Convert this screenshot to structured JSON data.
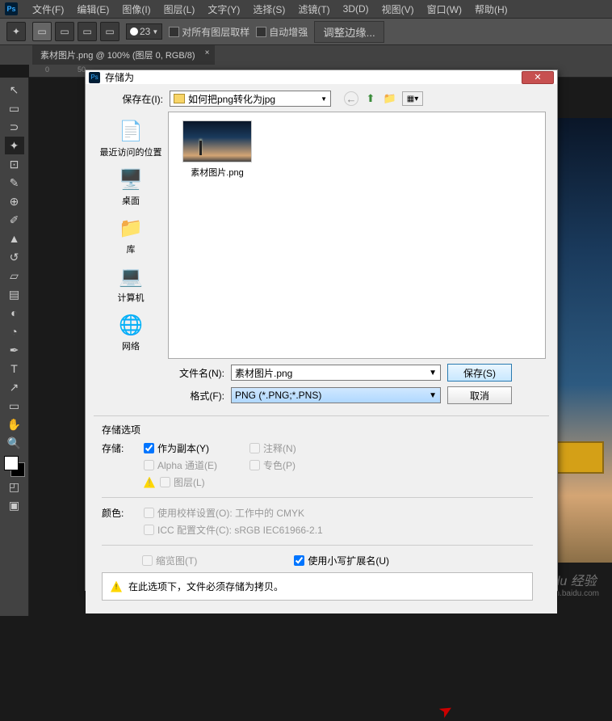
{
  "menubar": {
    "logo": "Ps",
    "items": [
      "文件(F)",
      "编辑(E)",
      "图像(I)",
      "图层(L)",
      "文字(Y)",
      "选择(S)",
      "滤镜(T)",
      "3D(D)",
      "视图(V)",
      "窗口(W)",
      "帮助(H)"
    ]
  },
  "optionsbar": {
    "size_value": "23",
    "chk1": "对所有图层取样",
    "chk2": "自动增强",
    "btn": "调整边缘..."
  },
  "tab": {
    "title": "素材图片.png @ 100% (图层 0, RGB/8)",
    "close": "×"
  },
  "dialog": {
    "title": "存储为",
    "close": "✕",
    "location_label": "保存在(I):",
    "location_value": "如何把png转化为jpg",
    "places": [
      {
        "label": "最近访问的位置",
        "icon": "📄"
      },
      {
        "label": "桌面",
        "icon": "🖥️"
      },
      {
        "label": "库",
        "icon": "📁"
      },
      {
        "label": "计算机",
        "icon": "💻"
      },
      {
        "label": "网络",
        "icon": "🌐"
      }
    ],
    "file_item": "素材图片.png",
    "filename_label": "文件名(N):",
    "filename_value": "素材图片.png",
    "format_label": "格式(F):",
    "format_value": "PNG (*.PNG;*.PNS)",
    "save_btn": "保存(S)",
    "cancel_btn": "取消",
    "options": {
      "heading": "存储选项",
      "save_label": "存储:",
      "as_copy": "作为副本(Y)",
      "alpha": "Alpha 通道(E)",
      "layers": "图层(L)",
      "notes": "注释(N)",
      "spot": "专色(P)",
      "color_label": "颜色:",
      "proof": "使用校样设置(O):  工作中的 CMYK",
      "icc": "ICC 配置文件(C):  sRGB IEC61966-2.1",
      "thumb": "缩览图(T)",
      "lowercase": "使用小写扩展名(U)",
      "info": "在此选项下，文件必须存储为拷贝。"
    }
  },
  "watermark": {
    "main": "Baidu 经验",
    "sub": "jingyan.baidu.com"
  }
}
